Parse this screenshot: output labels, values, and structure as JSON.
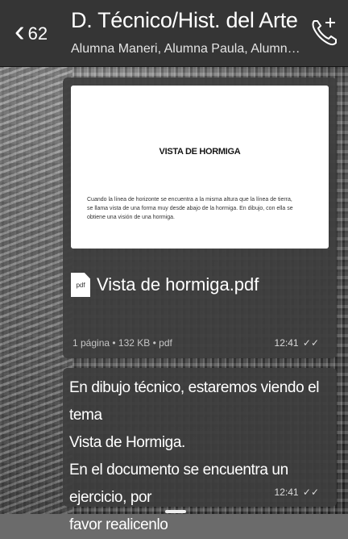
{
  "header": {
    "back_count": "62",
    "title": "D. Técnico/Hist. del Arte",
    "subtitle": "Alumna Maneri, Alumna Paula, Alumno Andersoa ..."
  },
  "icons": {
    "back": "chevron-left-icon",
    "call": "add-call-icon",
    "pdf": "pdf-file-icon",
    "read": "double-check-icon"
  },
  "document_message": {
    "preview_title": "VISTA DE HORMIGA",
    "preview_body": "Cuando la línea de horizonte se encuentra a la misma altura que la línea de tierra, se llama vista de una forma muy desde abajo de la hormiga. En dibujo, con ella se obtiene una visión de una hormiga.",
    "file_name": "Vista de hormiga.pdf",
    "file_meta": "1 página • 132 KB • pdf",
    "time": "12:41",
    "read_mark": "✓✓"
  },
  "text_message": {
    "lines": [
      "En dibujo técnico, estaremos viendo el tema",
      "Vista de Hormiga.",
      "En el documento se encuentra un ejercicio, por",
      "favor realicenlo"
    ],
    "time": "12:41",
    "read_mark": "✓✓"
  }
}
